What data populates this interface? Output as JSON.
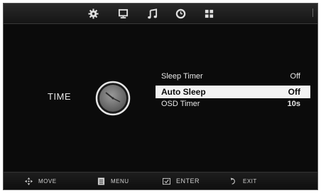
{
  "tabs": [
    {
      "icon": "gear-icon"
    },
    {
      "icon": "monitor-icon"
    },
    {
      "icon": "music-note-icon"
    },
    {
      "icon": "clock-icon"
    },
    {
      "icon": "grid-icon"
    }
  ],
  "page": {
    "title": "TIME",
    "icon": "analog-clock-icon"
  },
  "menu": {
    "items": [
      {
        "label": "Sleep Timer",
        "value": "Off"
      },
      {
        "label": "Auto Sleep",
        "value": "Off"
      },
      {
        "label": "OSD Timer",
        "value": "10s"
      }
    ],
    "selected_index": 1
  },
  "hints": [
    {
      "icon": "move-arrows-icon",
      "label": "MOVE"
    },
    {
      "icon": "menu-icon",
      "label": "MENU"
    },
    {
      "icon": "enter-icon",
      "label": "ENTER"
    },
    {
      "icon": "exit-icon",
      "label": "EXIT"
    }
  ],
  "colors": {
    "background": "#0b0b0b",
    "highlight": "#f2f2f2",
    "text": "#e8e8e8"
  }
}
